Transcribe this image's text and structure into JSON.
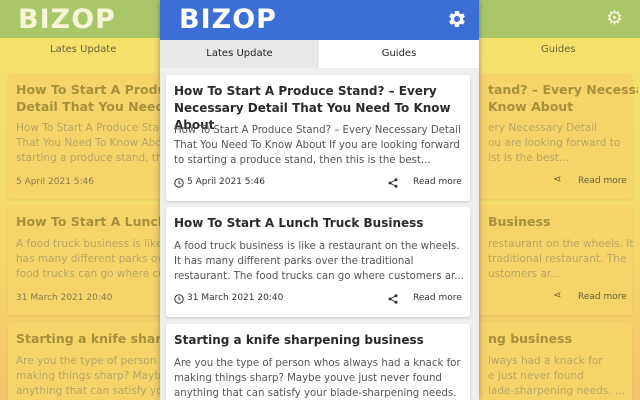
{
  "background": {
    "logo": "BIZOP",
    "tabs": [
      "Lates Update",
      "Guides"
    ],
    "left_titles": [
      "How To Start A Produce Stand? – Every Necessary",
      "Detail That You Need To Kno",
      "How To Start A Lunch Truck",
      "Starting a knife sharpening"
    ],
    "left_excerpts": [
      "How To Start A Produce Stand? – Ev",
      "That You Need To Know About If yo",
      "starting a produce stand, then th",
      "A food truck business is like a r",
      "has many different parks over the",
      "food trucks can go where custo",
      "Are you the type of person whos",
      "making things sharp? Maybe youve",
      "anything that can satisfy your"
    ],
    "left_dates": [
      "5 April 2021 5:46",
      "31 March 2021 20:40"
    ],
    "right_titles": [
      "tand? – Every Necessary",
      "Know About",
      "Business",
      "ng business"
    ],
    "right_excerpts": [
      "ery Necessary Detail",
      "ou are looking forward to",
      "ist is the best...",
      "restaurant on the wheels. It",
      "traditional restaurant. The",
      "ustomers ar...",
      "lways had a knack for",
      "e just never found",
      "lade-sharpening needs. ..."
    ],
    "right_more": "Read more"
  },
  "popup": {
    "logo": "BIZOP",
    "settings_icon": "gear-icon",
    "accent_color": "#3b6fd6",
    "tabs": [
      {
        "label": "Lates Update",
        "active": true
      },
      {
        "label": "Guides",
        "active": false
      }
    ],
    "articles": [
      {
        "title": "How To Start A Produce Stand? – Every Necessary Detail That You Need To Know About",
        "excerpt": "How To Start A Produce Stand? – Every Necessary Detail That You Need To Know About If you are looking forward to starting a produce stand, then this is the best...",
        "date": "5 April 2021 5:46",
        "more": "Read more"
      },
      {
        "title": "How To Start A Lunch Truck Business",
        "excerpt": "A food truck business is like a restaurant on the wheels. It has many different parks over the traditional restaurant. The food trucks can go where customers ar...",
        "date": "31 March 2021 20:40",
        "more": "Read more"
      },
      {
        "title": "Starting a knife sharpening business",
        "excerpt": "Are you the type of person whos always had a knack for making things sharp? Maybe youve just never found anything that can satisfy your blade-sharpening needs. ...",
        "date": "",
        "more": ""
      }
    ]
  }
}
